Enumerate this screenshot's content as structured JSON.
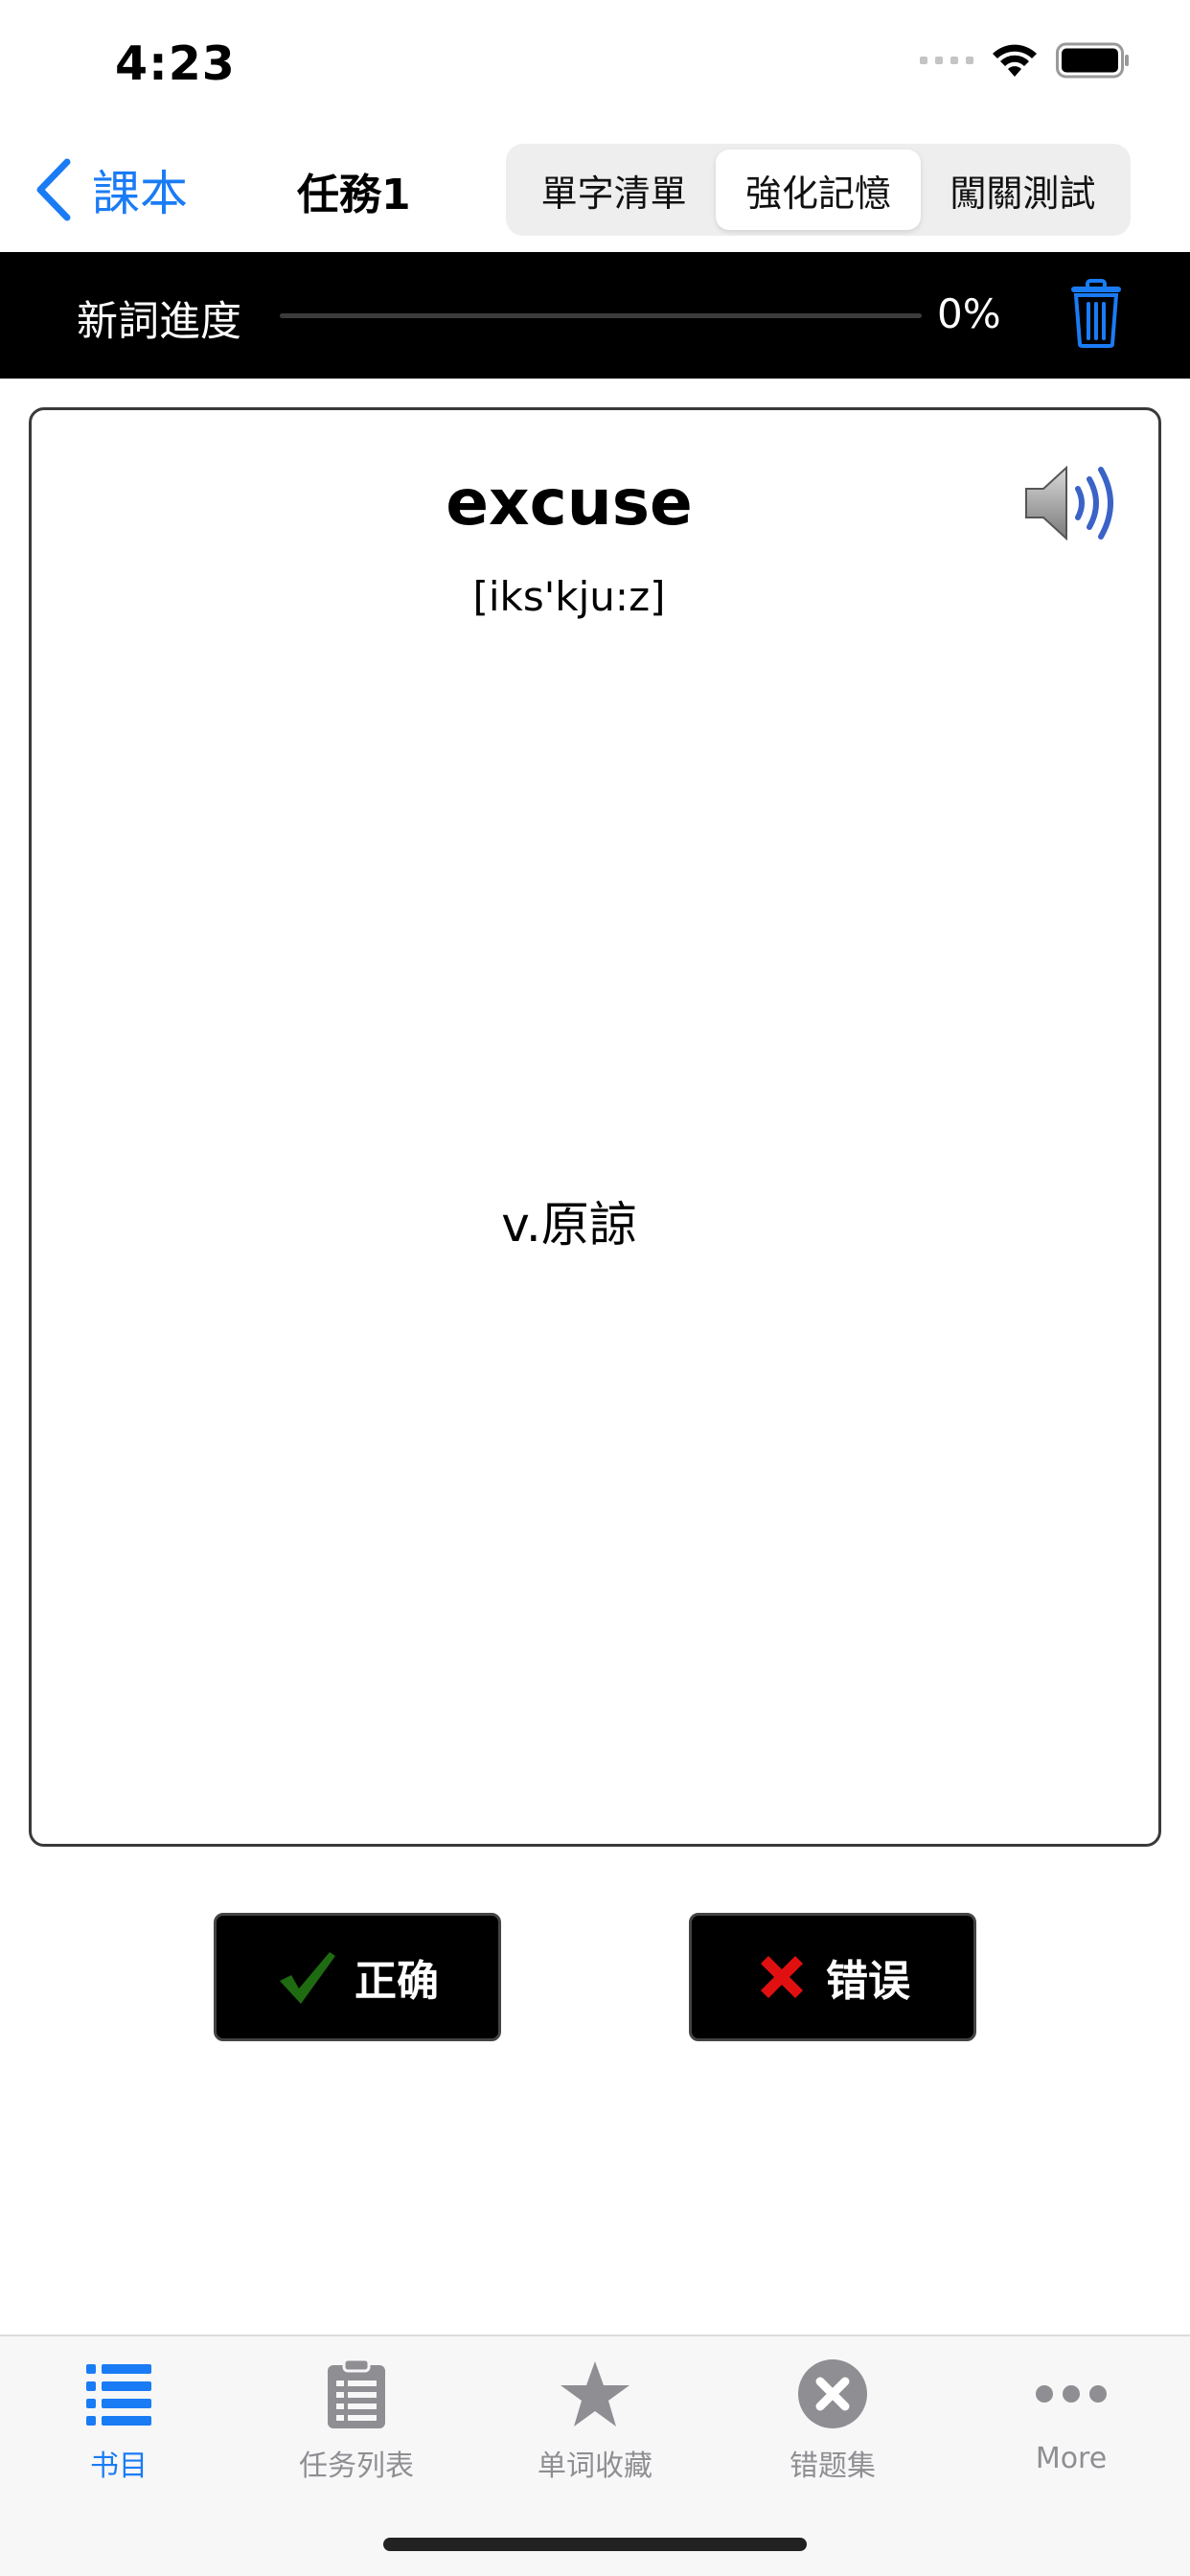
{
  "status_bar": {
    "time": "4:23"
  },
  "nav": {
    "back_label": "課本",
    "title": "任務1",
    "segments": [
      "單字清單",
      "強化記憶",
      "闖關測試"
    ],
    "active_segment": "強化記憶"
  },
  "progress": {
    "label": "新詞進度",
    "percent_text": "0%",
    "value": 0
  },
  "card": {
    "word": "excuse",
    "phonetic": "[iks'kju:z]",
    "meaning": "v.原諒"
  },
  "answers": {
    "correct_label": "正确",
    "wrong_label": "错误"
  },
  "tab_bar": {
    "tabs": [
      {
        "label": "书目",
        "icon": "list-icon",
        "active": true
      },
      {
        "label": "任务列表",
        "icon": "clipboard-icon",
        "active": false
      },
      {
        "label": "单词收藏",
        "icon": "star-icon",
        "active": false
      },
      {
        "label": "错题集",
        "icon": "x-circle-icon",
        "active": false
      },
      {
        "label": "More",
        "icon": "more-dots-icon",
        "active": false
      }
    ]
  },
  "colors": {
    "accent": "#1a7cf5",
    "inactive": "#8e8e93",
    "check": "#1f6b12",
    "cross": "#e11010"
  }
}
